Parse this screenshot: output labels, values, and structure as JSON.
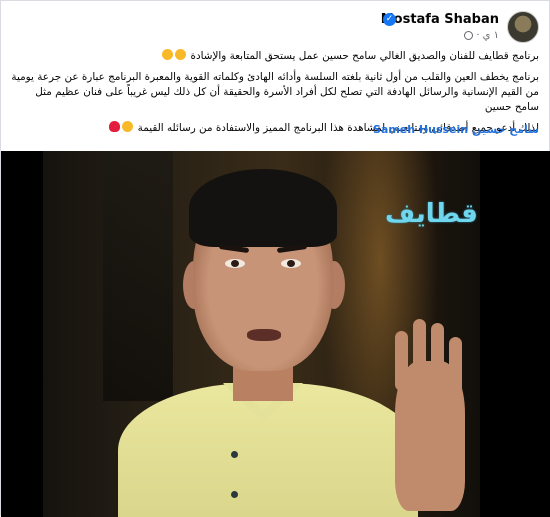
{
  "post": {
    "author": "Mostafa Shaban",
    "time": "١ ي",
    "paragraph1": "برنامج قطايف للفنان والصديق الغالي سامح حسين عمل يستحق المتابعة والإشادة",
    "paragraph2": "برنامج يخطف العين والقلب من أول ثانية بلغته السلسة وأدائه الهادئ وكلماته القوية والمعبرة البرنامج عبارة عن جرعة يومية من القيم الإنسانية والرسائل الهادفة التي تصلح لكل أفراد الأسرة والحقيقة أن كل ذلك ليس غريباً على فنان عظيم مثل سامح حسين",
    "paragraph3": "لذلك أدعو جميع أصدقائي ومتابعيني لمشاهدة هذا البرنامج المميز والاستفادة من رسائله القيمة",
    "tag_latin": "Sameh Hussein",
    "tag_arabic": "سامح حسين"
  },
  "video": {
    "watermark": "قطايف"
  },
  "icons": {
    "verified": "verified-badge-icon",
    "privacy": "globe-icon",
    "emoji1": "clapping-hands-emoji",
    "emoji2": "red-heart-emoji"
  },
  "colors": {
    "link": "#216fdb",
    "verified": "#1877f2",
    "shirt": "#eae79e",
    "watermark": "#6fd6ee"
  }
}
